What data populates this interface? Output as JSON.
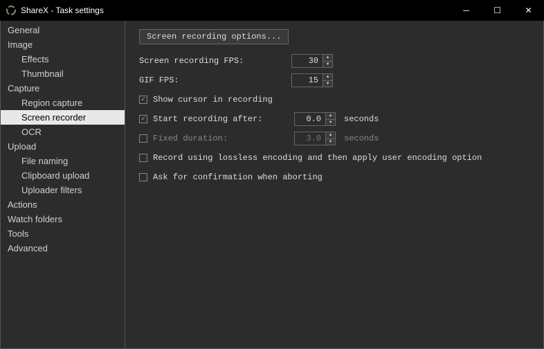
{
  "window": {
    "title": "ShareX - Task settings"
  },
  "sidebar": {
    "items": [
      {
        "label": "General",
        "level": 0
      },
      {
        "label": "Image",
        "level": 0
      },
      {
        "label": "Effects",
        "level": 1
      },
      {
        "label": "Thumbnail",
        "level": 1
      },
      {
        "label": "Capture",
        "level": 0
      },
      {
        "label": "Region capture",
        "level": 1
      },
      {
        "label": "Screen recorder",
        "level": 1,
        "selected": true
      },
      {
        "label": "OCR",
        "level": 1
      },
      {
        "label": "Upload",
        "level": 0
      },
      {
        "label": "File naming",
        "level": 1
      },
      {
        "label": "Clipboard upload",
        "level": 1
      },
      {
        "label": "Uploader filters",
        "level": 1
      },
      {
        "label": "Actions",
        "level": 0
      },
      {
        "label": "Watch folders",
        "level": 0
      },
      {
        "label": "Tools",
        "level": 0
      },
      {
        "label": "Advanced",
        "level": 0
      }
    ]
  },
  "panel": {
    "options_button": "Screen recording options...",
    "fps_label": "Screen recording FPS:",
    "fps_value": "30",
    "gif_fps_label": "GIF FPS:",
    "gif_fps_value": "15",
    "show_cursor_label": "Show cursor in recording",
    "show_cursor_checked": true,
    "start_after_label": "Start recording after:",
    "start_after_checked": true,
    "start_after_value": "0.0",
    "start_after_unit": "seconds",
    "fixed_duration_label": "Fixed duration:",
    "fixed_duration_checked": false,
    "fixed_duration_value": "3.0",
    "fixed_duration_unit": "seconds",
    "lossless_label": "Record using lossless encoding and then apply user encoding option",
    "lossless_checked": false,
    "confirm_abort_label": "Ask for confirmation when aborting",
    "confirm_abort_checked": false
  }
}
